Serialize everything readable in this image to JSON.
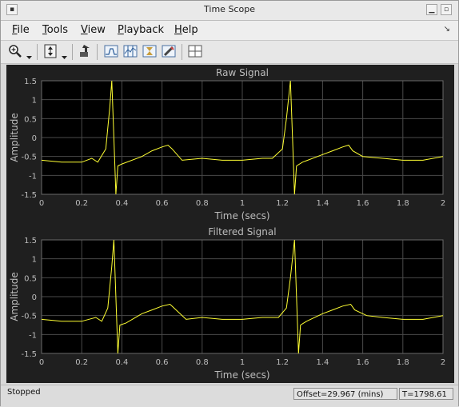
{
  "window": {
    "title": "Time Scope"
  },
  "menu": [
    "File",
    "Tools",
    "View",
    "Playback",
    "Help"
  ],
  "menu_underline": [
    "F",
    "T",
    "V",
    "P",
    "H"
  ],
  "toolbar": {
    "icons": [
      "zoom-in-icon",
      "zoom-dropdown-icon",
      "scale-axes-icon",
      "scale-dropdown-icon",
      "highlight-simulink-icon",
      "triggers-icon",
      "cursor-measurements-icon",
      "signal-statistics-icon",
      "peak-finder-icon",
      "layout-icon"
    ]
  },
  "status": {
    "state": "Stopped",
    "offset": "Offset=29.967 (mins)",
    "time": "T=1798.61"
  },
  "colors": {
    "background": "#1f1f1f",
    "axes_bg": "#000000",
    "grid": "#4a4a4a",
    "trace": "#ffff33",
    "label": "#bdbdbd"
  },
  "chart_data": [
    {
      "type": "line",
      "title": "Raw Signal",
      "xlabel": "Time (secs)",
      "ylabel": "Amplitude",
      "xlim": [
        0,
        2
      ],
      "ylim": [
        -1.5,
        1.5
      ],
      "xticks": [
        "0",
        "0.2",
        "0.4",
        "0.6",
        "0.8",
        "1",
        "1.2",
        "1.4",
        "1.6",
        "1.8",
        "2"
      ],
      "yticks": [
        "1.5",
        "1",
        "0.5",
        "0",
        "-0.5",
        "-1",
        "-1.5"
      ],
      "grid": true,
      "series": [
        {
          "x": [
            0,
            0.1,
            0.2,
            0.25,
            0.28,
            0.32,
            0.34,
            0.35,
            0.36,
            0.37,
            0.38,
            0.4,
            0.5,
            0.55,
            0.6,
            0.63,
            0.65,
            0.7,
            0.8,
            0.9,
            1.0,
            1.1,
            1.15,
            1.2,
            1.22,
            1.24,
            1.25,
            1.26,
            1.27,
            1.3,
            1.4,
            1.45,
            1.5,
            1.53,
            1.55,
            1.6,
            1.7,
            1.8,
            1.9,
            2.0
          ],
          "y": [
            -0.6,
            -0.65,
            -0.65,
            -0.55,
            -0.65,
            -0.3,
            0.8,
            1.5,
            0.0,
            -1.5,
            -0.75,
            -0.7,
            -0.5,
            -0.35,
            -0.25,
            -0.2,
            -0.3,
            -0.6,
            -0.55,
            -0.6,
            -0.6,
            -0.55,
            -0.55,
            -0.3,
            0.5,
            1.5,
            0.0,
            -1.5,
            -0.75,
            -0.65,
            -0.45,
            -0.35,
            -0.25,
            -0.2,
            -0.35,
            -0.5,
            -0.55,
            -0.6,
            -0.6,
            -0.5
          ]
        }
      ]
    },
    {
      "type": "line",
      "title": "Filtered Signal",
      "xlabel": "Time (secs)",
      "ylabel": "Amplitude",
      "xlim": [
        0,
        2
      ],
      "ylim": [
        -1.5,
        1.5
      ],
      "xticks": [
        "0",
        "0.2",
        "0.4",
        "0.6",
        "0.8",
        "1",
        "1.2",
        "1.4",
        "1.6",
        "1.8",
        "2"
      ],
      "yticks": [
        "1.5",
        "1",
        "0.5",
        "0",
        "-0.5",
        "-1",
        "-1.5"
      ],
      "grid": true,
      "series": [
        {
          "x": [
            0,
            0.1,
            0.2,
            0.27,
            0.3,
            0.33,
            0.35,
            0.36,
            0.37,
            0.38,
            0.39,
            0.42,
            0.5,
            0.55,
            0.6,
            0.64,
            0.67,
            0.72,
            0.8,
            0.9,
            1.0,
            1.1,
            1.18,
            1.22,
            1.24,
            1.26,
            1.27,
            1.28,
            1.29,
            1.32,
            1.4,
            1.45,
            1.5,
            1.54,
            1.56,
            1.62,
            1.7,
            1.8,
            1.9,
            2.0
          ],
          "y": [
            -0.6,
            -0.65,
            -0.65,
            -0.55,
            -0.65,
            -0.3,
            0.8,
            1.5,
            0.0,
            -1.5,
            -0.75,
            -0.7,
            -0.45,
            -0.35,
            -0.25,
            -0.2,
            -0.35,
            -0.6,
            -0.55,
            -0.6,
            -0.6,
            -0.55,
            -0.55,
            -0.3,
            0.5,
            1.5,
            0.0,
            -1.5,
            -0.75,
            -0.65,
            -0.45,
            -0.35,
            -0.25,
            -0.2,
            -0.35,
            -0.5,
            -0.55,
            -0.6,
            -0.6,
            -0.5
          ]
        }
      ]
    }
  ]
}
